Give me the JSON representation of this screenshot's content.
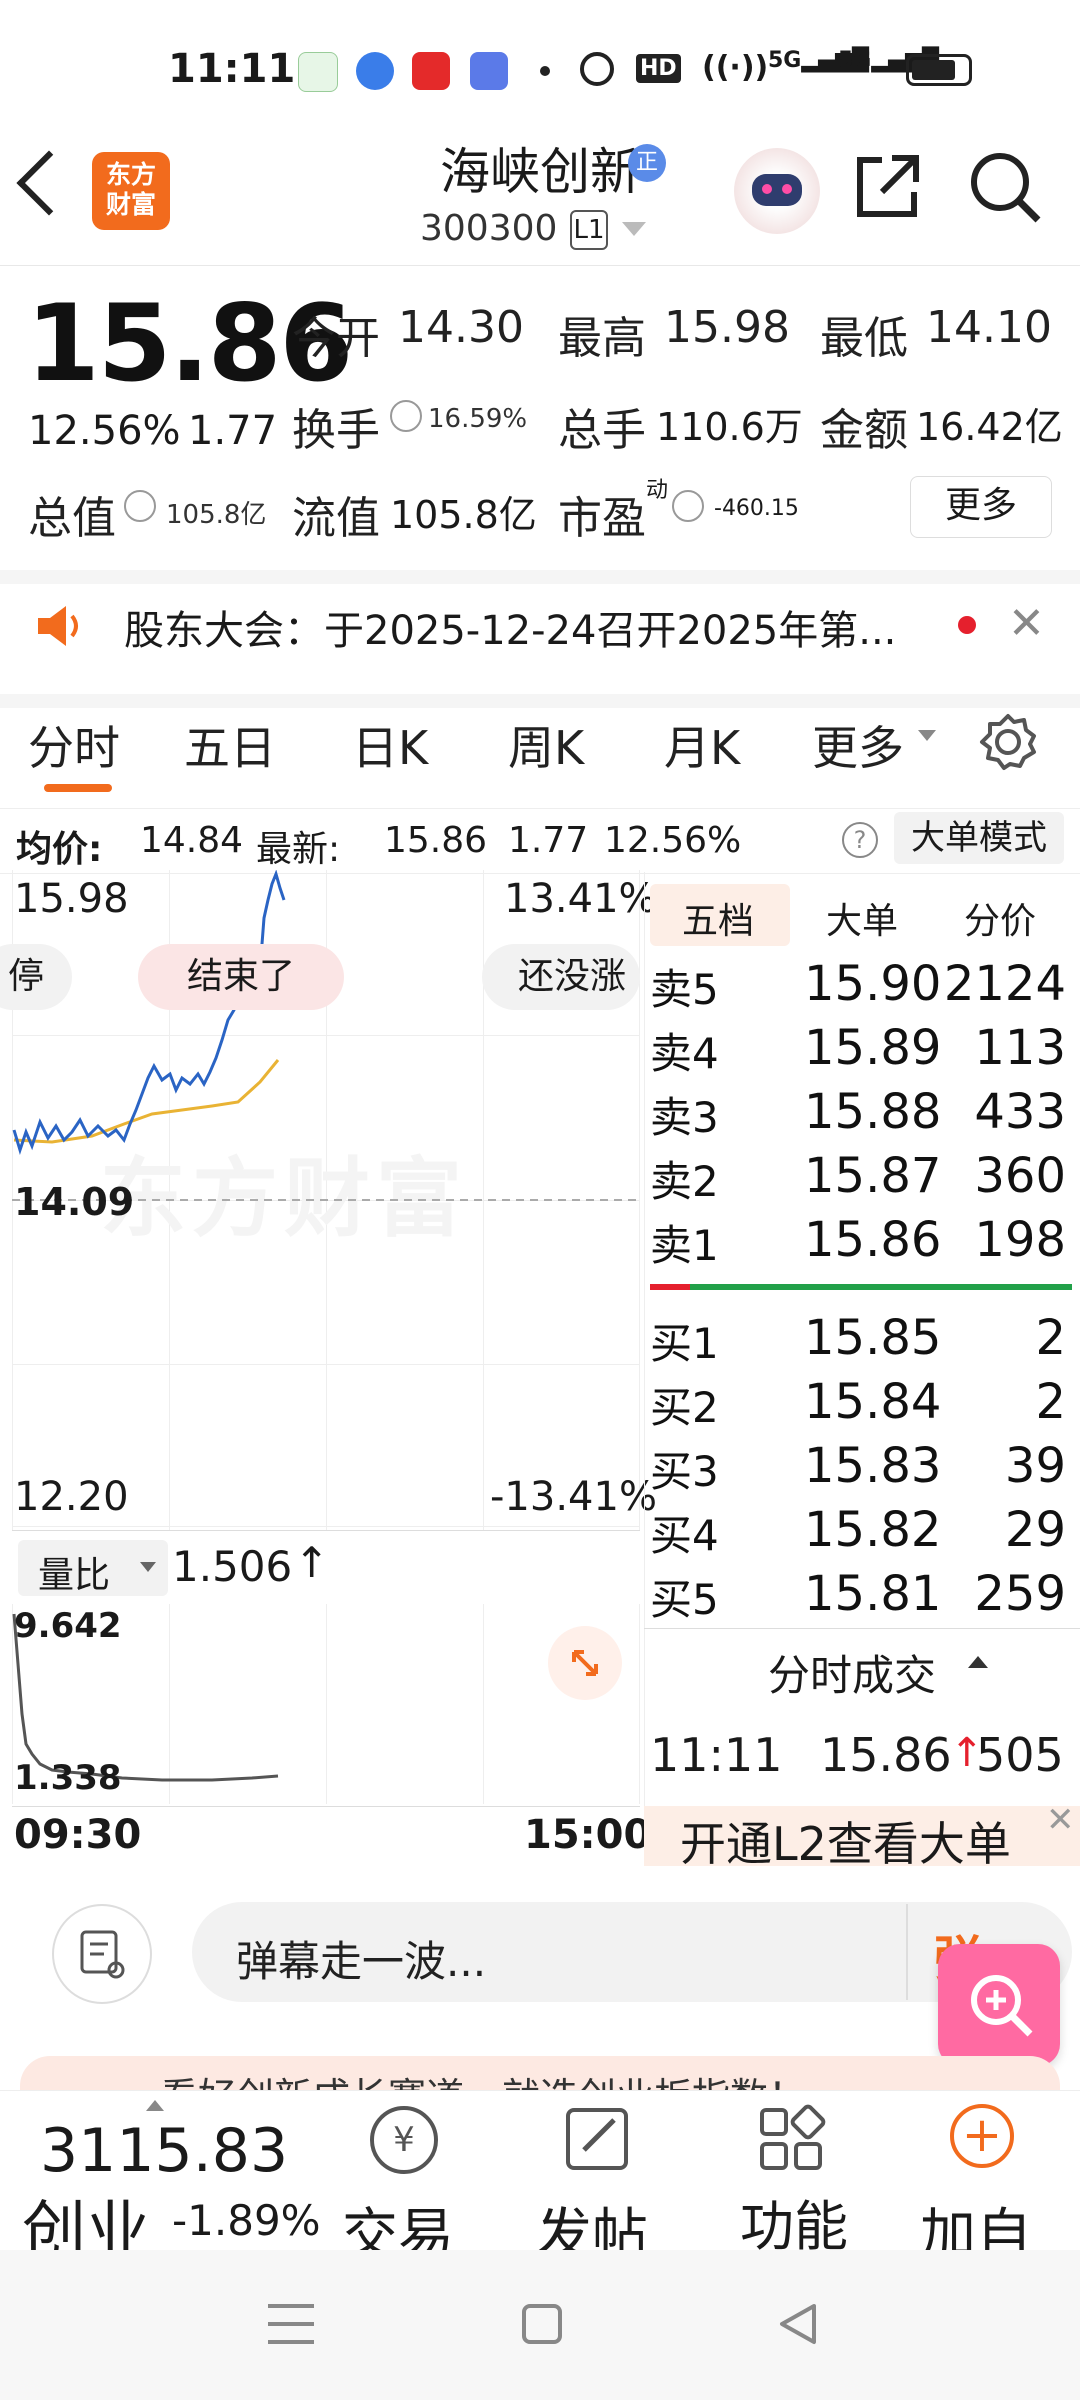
{
  "status_bar": {
    "time": "11:11",
    "network": "5G",
    "hd": "HD"
  },
  "header": {
    "logo_text": "东方\n财富",
    "stock_name": "海峡创新",
    "badge": "正",
    "stock_code": "300300",
    "level": "L1"
  },
  "quote": {
    "price": "15.86",
    "change_pct": "12.56%",
    "change_amt": "1.77",
    "open_label": "今开",
    "open": "14.30",
    "high_label": "最高",
    "high": "15.98",
    "low_label": "最低",
    "low": "14.10",
    "turnover_label": "换手",
    "turnover": "16.59%",
    "volume_label": "总手",
    "volume": "110.6万",
    "amount_label": "金额",
    "amount": "16.42亿",
    "mcap_label": "总值",
    "mcap": "105.8亿",
    "float_label": "流值",
    "float_cap": "105.8亿",
    "pe_label": "市盈",
    "pe_sup": "动",
    "pe": "-460.15",
    "more_label": "更多"
  },
  "notice": {
    "text": "股东大会：于2025-12-24召开2025年第..."
  },
  "tabs": [
    {
      "label": "分时"
    },
    {
      "label": "五日"
    },
    {
      "label": "日K"
    },
    {
      "label": "周K"
    },
    {
      "label": "月K"
    },
    {
      "label": "更多"
    }
  ],
  "info_bar": {
    "avg_label": "均价:",
    "avg": "14.84",
    "latest_label": "最新:",
    "latest": "15.86",
    "chg": "1.77",
    "pct": "12.56%",
    "mode_label": "大单模式"
  },
  "chart": {
    "y_top": "15.98",
    "y_mid": "14.09",
    "y_bottom": "12.20",
    "pct_top": "13.41%",
    "pct_bottom": "-13.41%",
    "bubble_left": "停",
    "bubble_mid": "结束了",
    "bubble_right": "还没涨",
    "watermark": "东方财富",
    "ratio_label": "量比",
    "ratio_value": "1.506",
    "vol_top": "9.642",
    "vol_bottom": "1.338",
    "time_start": "09:30",
    "time_end": "15:00"
  },
  "orderbook": {
    "tabs": [
      {
        "label": "五档"
      },
      {
        "label": "大单"
      },
      {
        "label": "分价"
      }
    ],
    "asks": [
      {
        "label": "卖5",
        "price": "15.90",
        "qty": "2124"
      },
      {
        "label": "卖4",
        "price": "15.89",
        "qty": "113"
      },
      {
        "label": "卖3",
        "price": "15.88",
        "qty": "433"
      },
      {
        "label": "卖2",
        "price": "15.87",
        "qty": "360"
      },
      {
        "label": "卖1",
        "price": "15.86",
        "qty": "198"
      }
    ],
    "bids": [
      {
        "label": "买1",
        "price": "15.85",
        "qty": "2"
      },
      {
        "label": "买2",
        "price": "15.84",
        "qty": "2"
      },
      {
        "label": "买3",
        "price": "15.83",
        "qty": "39"
      },
      {
        "label": "买4",
        "price": "15.82",
        "qty": "29"
      },
      {
        "label": "买5",
        "price": "15.81",
        "qty": "259"
      }
    ],
    "trades_label": "分时成交",
    "trade_time": "11:11",
    "trade_price": "15.86",
    "trade_qty": "505",
    "l2_label": "开通L2查看大单"
  },
  "comment": {
    "placeholder": "弹幕走一波...",
    "danmu": "弹"
  },
  "banner": {
    "text": "看好创新成长赛道，就选创业板指数！"
  },
  "bottom_nav": {
    "index_value": "3115.83",
    "index_name": "创业",
    "index_pct": "-1.89%",
    "items": [
      {
        "label": "交易"
      },
      {
        "label": "发帖"
      },
      {
        "label": "功能"
      },
      {
        "label": "加自"
      }
    ]
  },
  "colors": {
    "accent": "#f26b1d",
    "up": "#e5202d",
    "down": "#21a049",
    "line": "#2a64c4",
    "avg": "#e9b334"
  }
}
